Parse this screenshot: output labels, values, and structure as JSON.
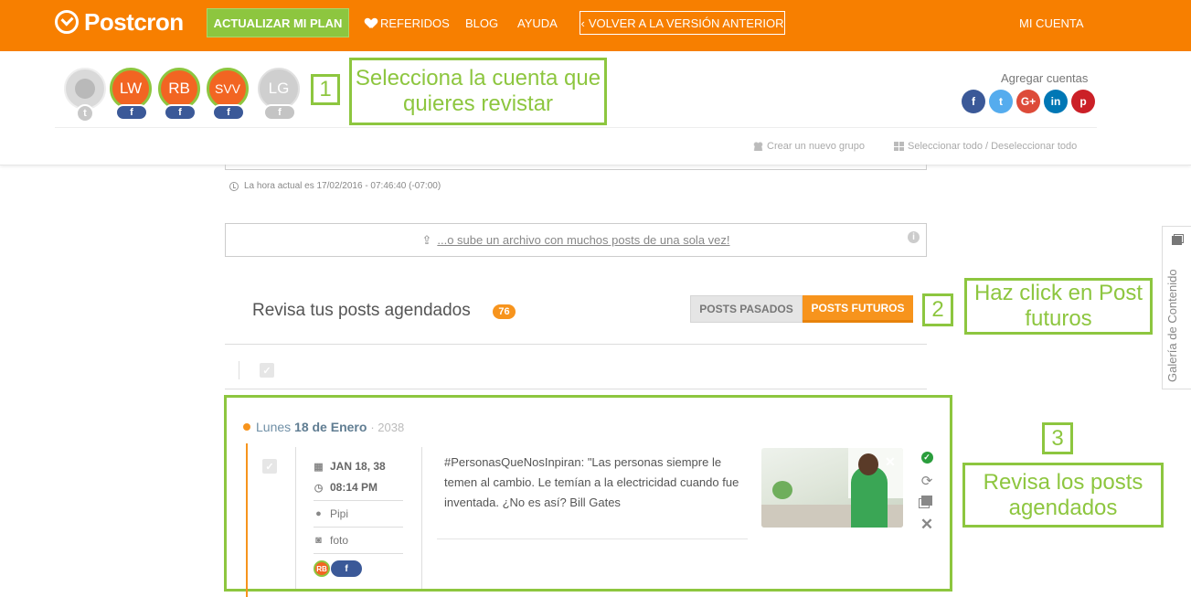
{
  "nav": {
    "logo": "Postcron",
    "upgrade": "ACTUALIZAR MI PLAN",
    "referrals": "REFERIDOS",
    "blog": "BLOG",
    "help": "AYUDA",
    "previous_version": "VOLVER A LA VERSIÓN ANTERIOR",
    "account": "MI CUENTA"
  },
  "accounts": {
    "items": [
      {
        "initials": "",
        "network": "twitter",
        "badge": "t"
      },
      {
        "initials": "LW",
        "network": "facebook",
        "badge": "f"
      },
      {
        "initials": "RB",
        "network": "facebook",
        "badge": "f"
      },
      {
        "initials": "SVV",
        "network": "facebook",
        "badge": "f"
      },
      {
        "initials": "LG",
        "network": "facebook",
        "badge": "f"
      }
    ],
    "add_label": "Agregar cuentas",
    "add_networks": [
      "f",
      "t",
      "G+",
      "in",
      "p"
    ],
    "create_group": "Crear un nuevo grupo",
    "select_all": "Seleccionar todo / Deseleccionar todo"
  },
  "steps": {
    "one_num": "1",
    "one_text": "Selecciona la cuenta que quieres revistar",
    "two_num": "2",
    "two_text": "Haz click en Post futuros",
    "three_num": "3",
    "three_text": "Revisa los posts agendados"
  },
  "composer": {
    "current_time": "La hora actual es 17/02/2016 - 07:46:40 (-07:00)",
    "upload": "...o sube un archivo con muchos posts de una sola vez!",
    "info": "i"
  },
  "scheduled": {
    "title": "Revisa tus posts agendados",
    "count": "76",
    "tab_past": "POSTS PASADOS",
    "tab_future": "POSTS FUTUROS",
    "day_prefix": "Lunes",
    "day_bold": "18 de Enero",
    "day_year": "· 2038",
    "post": {
      "date": "JAN 18, 38",
      "time": "08:14 PM",
      "user": "Pipi",
      "type": "foto",
      "account_initials": "RB",
      "account_network": "f",
      "text": "#PersonasQueNosInpiran: \"Las personas siempre le temen al cambio. Le temían a la electricidad cuando fue inventada. ¿No es así? Bill Gates"
    }
  },
  "side_tab": {
    "label": "Galería de Contenido"
  }
}
